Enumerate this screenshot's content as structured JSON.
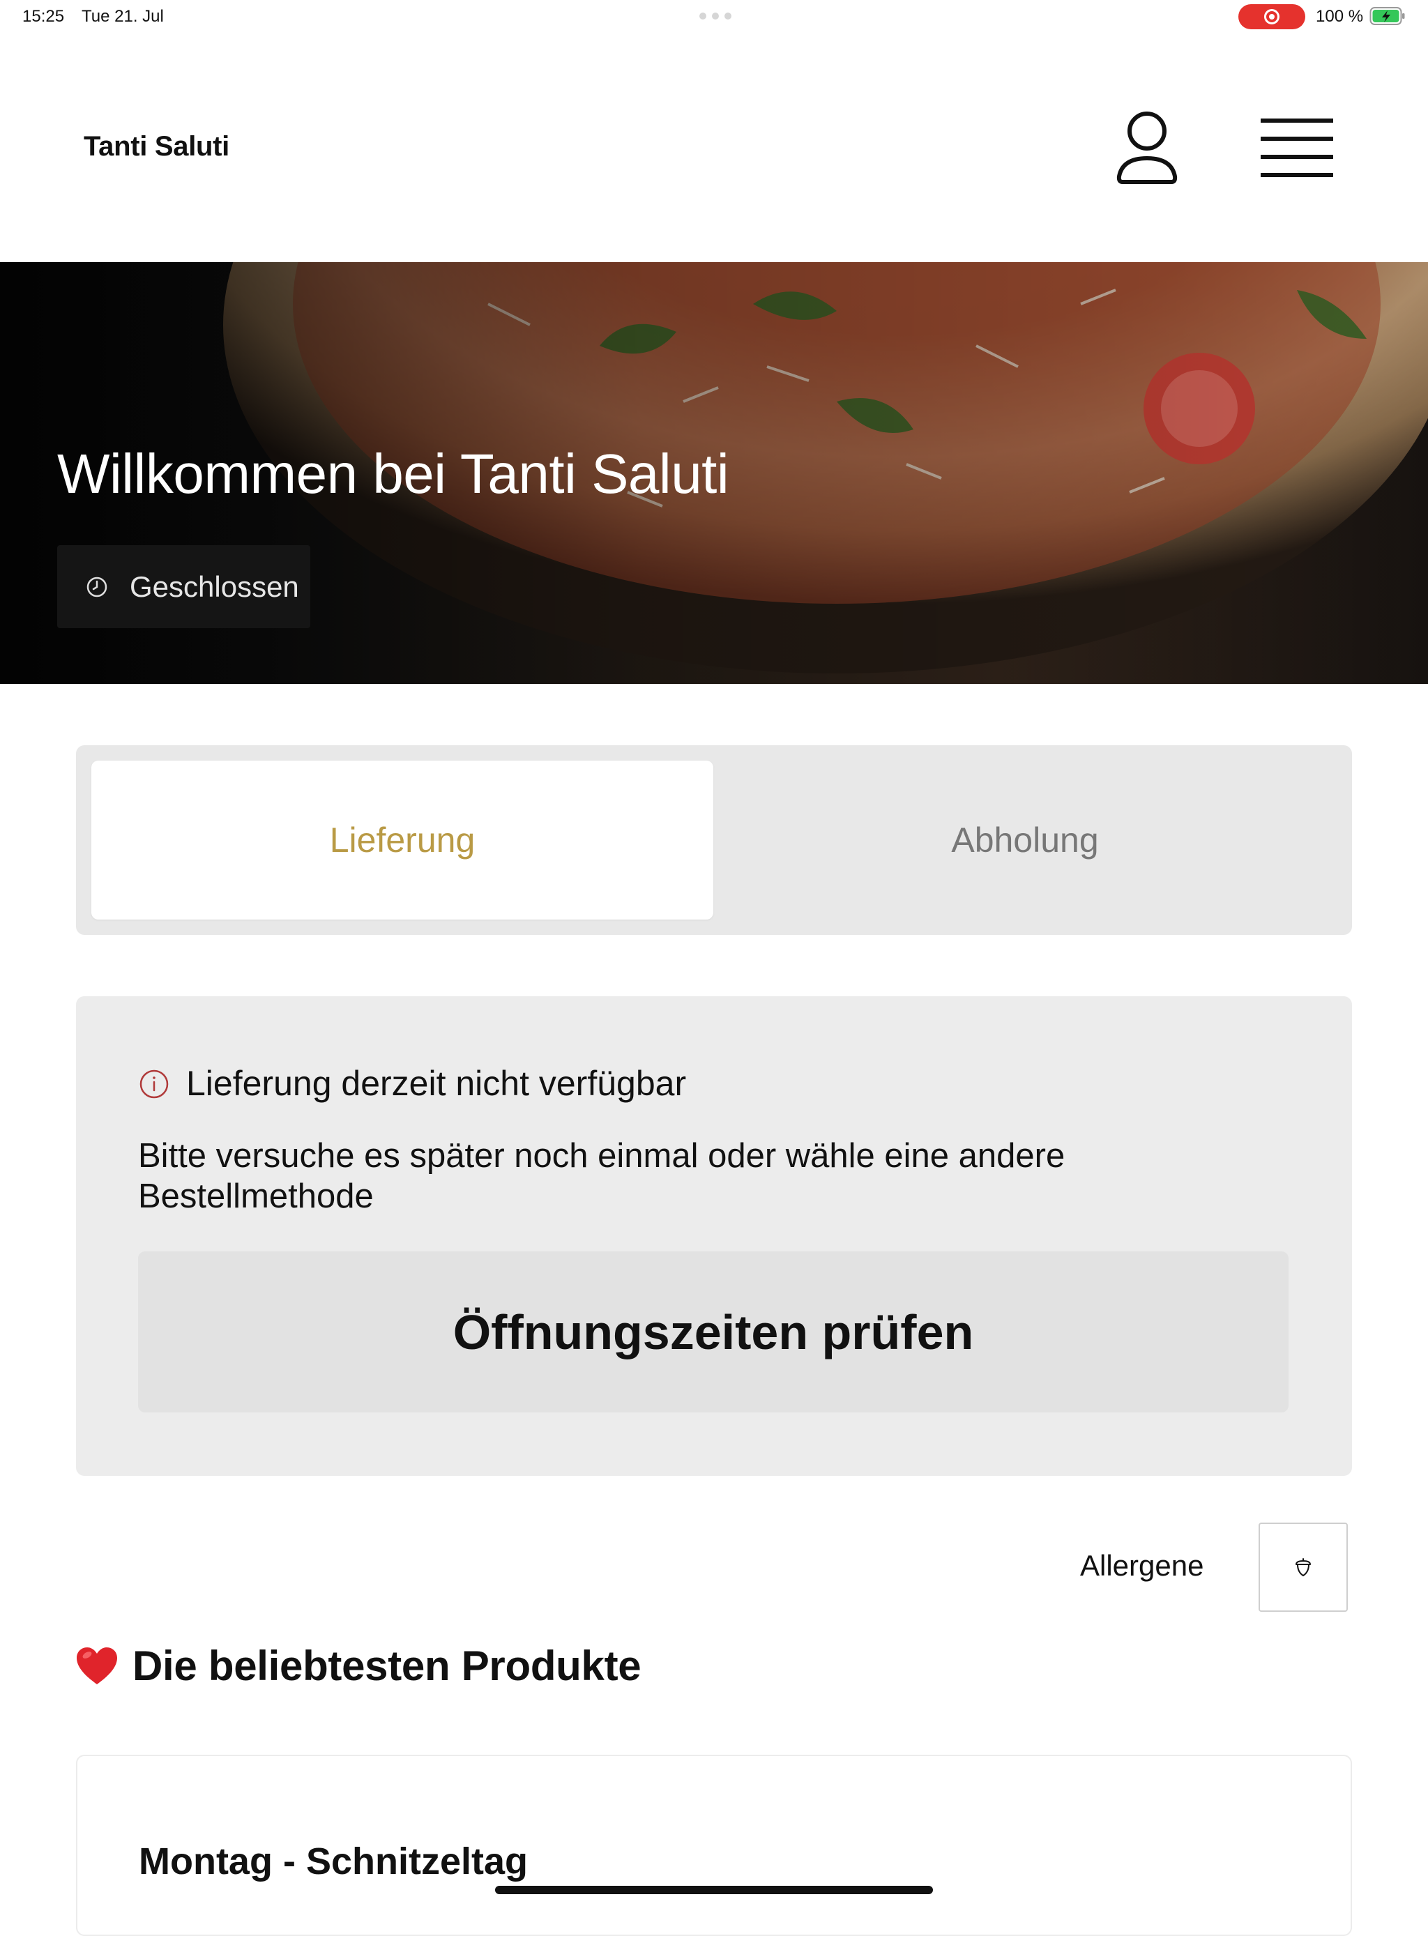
{
  "status_bar": {
    "time": "15:25",
    "date": "Tue 21. Jul",
    "battery": "100 %",
    "recording_color": "#e5322d"
  },
  "header": {
    "brand": "Tanti Saluti",
    "icons": [
      "user-icon",
      "menu-icon"
    ]
  },
  "hero": {
    "title": "Willkommen bei Tanti Saluti",
    "status_label": "Geschlossen",
    "status_icon": "clock-icon"
  },
  "order_method": {
    "tabs": [
      {
        "label": "Lieferung",
        "active": true
      },
      {
        "label": "Abholung",
        "active": false
      }
    ],
    "active_color": "#b99a45"
  },
  "notice": {
    "title": "Lieferung derzeit nicht verfügbar",
    "text": "Bitte versuche es später noch einmal oder wähle eine andere Bestellmethode",
    "button_label": "Öffnungszeiten prüfen",
    "icon": "info-icon",
    "icon_color": "#b03a3a"
  },
  "allergens": {
    "label": "Allergene",
    "icon": "acorn-icon"
  },
  "popular": {
    "heading": "Die beliebtesten Produkte",
    "icon": "heart-icon"
  },
  "products": [
    {
      "title": "Montag - Schnitzeltag"
    }
  ]
}
